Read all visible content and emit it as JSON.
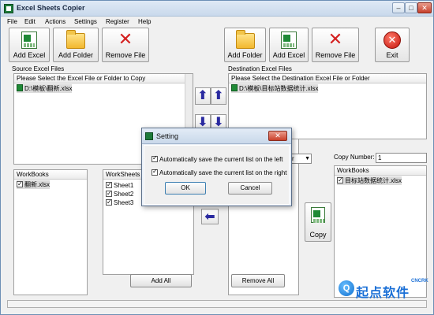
{
  "window": {
    "title": "Excel Sheets Copier"
  },
  "menu": [
    "File",
    "Edit",
    "Actions",
    "Settings",
    "Register",
    "Help"
  ],
  "left_toolbar": {
    "add_excel": "Add Excel",
    "add_folder": "Add Folder",
    "remove_file": "Remove File"
  },
  "right_toolbar": {
    "add_folder": "Add Folder",
    "add_excel": "Add Excel",
    "remove_file": "Remove File",
    "exit": "Exit"
  },
  "source": {
    "group_label": "Source Excel Files",
    "header": "Please Select the Excel File or Folder to Copy",
    "files": [
      "D:\\模板\\翻新.xlsx"
    ]
  },
  "destination": {
    "group_label": "Destination Excel Files",
    "header": "Please Select the Destination Excel File or Folder",
    "files": [
      "D:\\模板\\目标站数据统计.xlsx"
    ]
  },
  "left_workbooks": {
    "header": "WorkBooks",
    "items": [
      "翻新.xlsx"
    ]
  },
  "left_worksheets": {
    "header": "WorkSheets",
    "items": [
      "Sheet1",
      "Sheet2",
      "Sheet3"
    ]
  },
  "right_workbooks": {
    "header": "WorkBooks",
    "items": [
      "目标站数据统计.xlsx"
    ]
  },
  "copy_number": {
    "label": "Copy Number:",
    "value": "1"
  },
  "position_select": {
    "value": "r"
  },
  "buttons": {
    "add_all": "Add All",
    "remove_all": "Remove All",
    "copy": "Copy"
  },
  "dialog": {
    "title": "Setting",
    "options": [
      "Automatically save the current list on the left",
      "Automatically save the current list on the right"
    ],
    "ok": "OK",
    "cancel": "Cancel"
  },
  "watermark": {
    "text": "起点软件",
    "sub": "CNCRK",
    "badge": "Q"
  }
}
